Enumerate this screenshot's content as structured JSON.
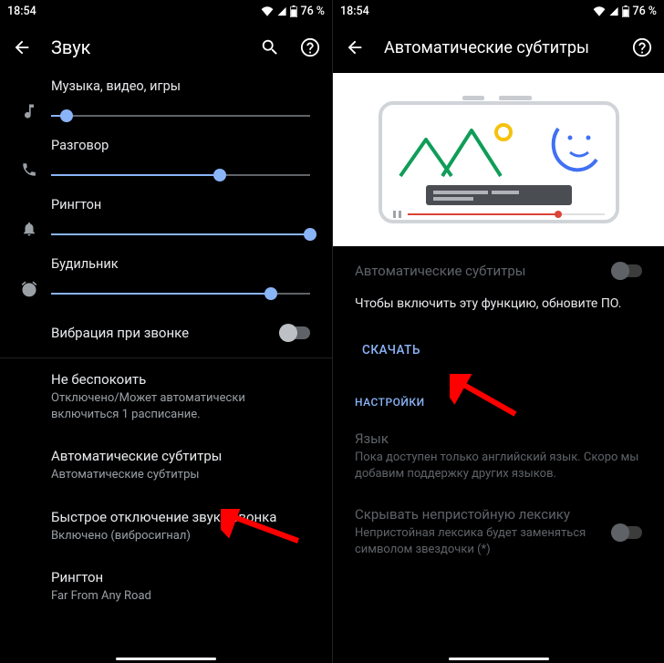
{
  "status": {
    "time": "18:54",
    "battery_text": "76 %"
  },
  "pane1": {
    "title": "Звук",
    "sliders": [
      {
        "label": "Музыка, видео, игры",
        "percent": 6
      },
      {
        "label": "Разговор",
        "percent": 65
      },
      {
        "label": "Рингтон",
        "percent": 100
      },
      {
        "label": "Будильник",
        "percent": 85
      }
    ],
    "vibrate_label": "Вибрация при звонке",
    "items": [
      {
        "primary": "Не беспокоить",
        "secondary": "Отключено/Может автоматически включиться 1 расписание."
      },
      {
        "primary": "Автоматические субтитры",
        "secondary": "Автоматические субтитры"
      },
      {
        "primary": "Быстрое отключение звука звонка",
        "secondary": "Включено (вибросигнал)"
      },
      {
        "primary": "Рингтон",
        "secondary": "Far From Any Road"
      }
    ]
  },
  "pane2": {
    "title": "Автоматические субтитры",
    "toggle_label": "Автоматические субтитры",
    "description": "Чтобы включить эту функцию, обновите ПО.",
    "download_label": "СКАЧАТЬ",
    "section_header": "НАСТРОЙКИ",
    "lang": {
      "primary": "Язык",
      "secondary": "Пока доступен только английский язык. Скоро мы добавим поддержку других языков."
    },
    "profanity": {
      "primary": "Скрывать непристойную лексику",
      "secondary": "Непристойная лексика будет заменяться символом звездочки (*)"
    }
  }
}
